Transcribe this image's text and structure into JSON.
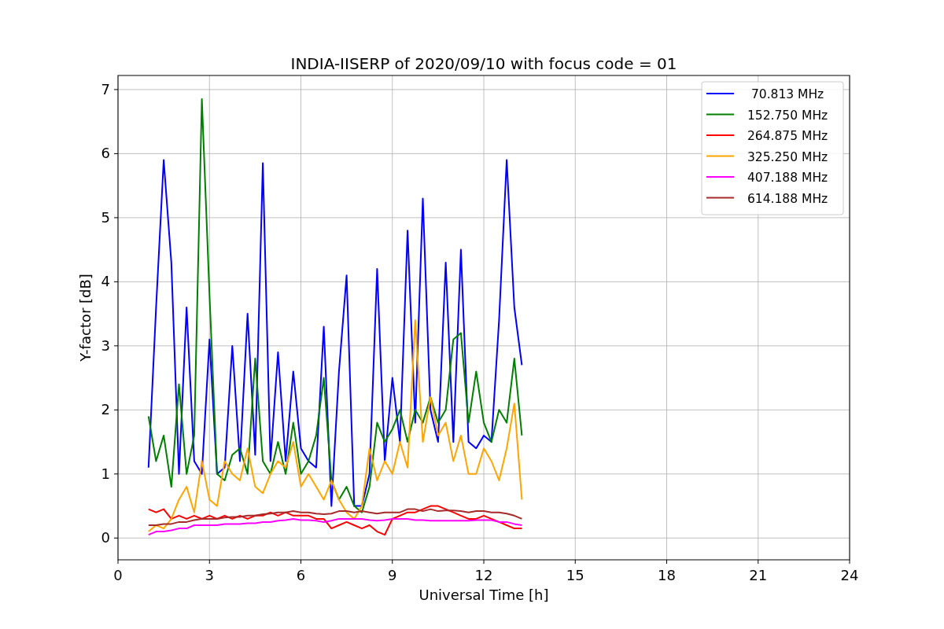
{
  "figure": {
    "chart_data": {
      "type": "line",
      "title": "INDIA-IISERP of 2020/09/10 with focus code = 01",
      "xlabel": "Universal Time [h]",
      "ylabel": "Y-factor [dB]",
      "x": [
        1,
        1.25,
        1.5,
        1.75,
        2,
        2.25,
        2.5,
        2.75,
        3,
        3.25,
        3.5,
        3.75,
        4,
        4.25,
        4.5,
        4.75,
        5,
        5.25,
        5.5,
        5.75,
        6,
        6.25,
        6.5,
        6.75,
        7,
        7.25,
        7.5,
        7.75,
        8,
        8.25,
        8.5,
        8.75,
        9,
        9.25,
        9.5,
        9.75,
        10,
        10.25,
        10.5,
        10.75,
        11,
        11.25,
        11.5,
        11.75,
        12,
        12.25,
        12.5,
        12.75,
        13,
        13.25
      ],
      "series": [
        {
          "name": " 70.813 MHz",
          "color": "#0000ff",
          "values": [
            1.1,
            3.6,
            5.9,
            4.3,
            1.0,
            3.6,
            1.2,
            1.0,
            3.1,
            1.0,
            1.1,
            3.0,
            1.2,
            3.5,
            1.3,
            5.85,
            1.2,
            2.9,
            1.2,
            2.6,
            1.4,
            1.2,
            1.1,
            3.3,
            0.5,
            2.6,
            4.1,
            0.5,
            0.5,
            1.0,
            4.2,
            1.2,
            2.5,
            1.5,
            4.8,
            1.8,
            5.3,
            2.0,
            1.5,
            4.3,
            1.5,
            4.5,
            1.5,
            1.4,
            1.6,
            1.5,
            3.4,
            5.9,
            3.6,
            2.7
          ]
        },
        {
          "name": "152.750 MHz",
          "color": "#008000",
          "values": [
            1.9,
            1.2,
            1.6,
            0.8,
            2.4,
            1.0,
            1.6,
            6.85,
            3.8,
            1.0,
            0.9,
            1.3,
            1.4,
            1.0,
            2.8,
            1.2,
            1.0,
            1.5,
            1.0,
            1.8,
            1.0,
            1.2,
            1.6,
            2.5,
            0.9,
            0.6,
            0.8,
            0.5,
            0.4,
            0.8,
            1.8,
            1.5,
            1.7,
            2.0,
            1.5,
            2.0,
            1.8,
            2.2,
            1.8,
            2.0,
            3.1,
            3.2,
            1.8,
            2.6,
            1.8,
            1.5,
            2.0,
            1.8,
            2.8,
            1.6
          ]
        },
        {
          "name": "264.875 MHz",
          "color": "#ff0000",
          "values": [
            0.45,
            0.4,
            0.45,
            0.3,
            0.35,
            0.3,
            0.35,
            0.3,
            0.35,
            0.3,
            0.35,
            0.3,
            0.35,
            0.3,
            0.35,
            0.35,
            0.4,
            0.35,
            0.4,
            0.35,
            0.35,
            0.35,
            0.3,
            0.3,
            0.15,
            0.2,
            0.25,
            0.2,
            0.15,
            0.2,
            0.1,
            0.05,
            0.3,
            0.35,
            0.4,
            0.4,
            0.45,
            0.5,
            0.5,
            0.45,
            0.4,
            0.35,
            0.3,
            0.3,
            0.35,
            0.3,
            0.25,
            0.2,
            0.15,
            0.15
          ]
        },
        {
          "name": "325.250 MHz",
          "color": "#ffa500",
          "values": [
            0.1,
            0.2,
            0.15,
            0.3,
            0.6,
            0.8,
            0.4,
            1.2,
            0.6,
            0.5,
            1.2,
            1.0,
            0.9,
            1.4,
            0.8,
            0.7,
            1.0,
            1.2,
            1.1,
            1.5,
            0.8,
            1.0,
            0.8,
            0.6,
            0.9,
            0.6,
            0.4,
            0.3,
            0.5,
            1.4,
            0.9,
            1.2,
            1.0,
            1.5,
            1.1,
            3.4,
            1.5,
            2.2,
            1.6,
            1.8,
            1.2,
            1.6,
            1.0,
            1.0,
            1.4,
            1.2,
            0.9,
            1.4,
            2.1,
            0.6
          ]
        },
        {
          "name": "407.188 MHz",
          "color": "#ff00ff",
          "values": [
            0.05,
            0.1,
            0.1,
            0.12,
            0.15,
            0.15,
            0.2,
            0.2,
            0.2,
            0.2,
            0.22,
            0.22,
            0.22,
            0.23,
            0.23,
            0.25,
            0.25,
            0.27,
            0.28,
            0.3,
            0.28,
            0.28,
            0.27,
            0.25,
            0.27,
            0.3,
            0.3,
            0.3,
            0.3,
            0.28,
            0.27,
            0.28,
            0.3,
            0.3,
            0.3,
            0.28,
            0.28,
            0.27,
            0.27,
            0.27,
            0.27,
            0.27,
            0.27,
            0.28,
            0.28,
            0.28,
            0.25,
            0.25,
            0.22,
            0.2
          ]
        },
        {
          "name": "614.188 MHz",
          "color": "#a52a2a",
          "values": [
            0.2,
            0.2,
            0.22,
            0.22,
            0.25,
            0.25,
            0.28,
            0.3,
            0.3,
            0.3,
            0.32,
            0.33,
            0.33,
            0.35,
            0.35,
            0.37,
            0.38,
            0.4,
            0.4,
            0.42,
            0.4,
            0.4,
            0.38,
            0.37,
            0.38,
            0.42,
            0.42,
            0.4,
            0.42,
            0.4,
            0.38,
            0.4,
            0.4,
            0.4,
            0.45,
            0.45,
            0.42,
            0.45,
            0.42,
            0.43,
            0.43,
            0.42,
            0.4,
            0.42,
            0.42,
            0.4,
            0.4,
            0.38,
            0.35,
            0.3
          ]
        }
      ],
      "grid": true,
      "legend": true,
      "xlim": [
        0,
        24
      ],
      "ylim": [
        -0.34,
        7.22
      ],
      "xticks": [
        0,
        3,
        6,
        9,
        12,
        15,
        18,
        21,
        24
      ],
      "yticks": [
        0,
        1,
        2,
        3,
        4,
        5,
        6,
        7
      ]
    }
  }
}
